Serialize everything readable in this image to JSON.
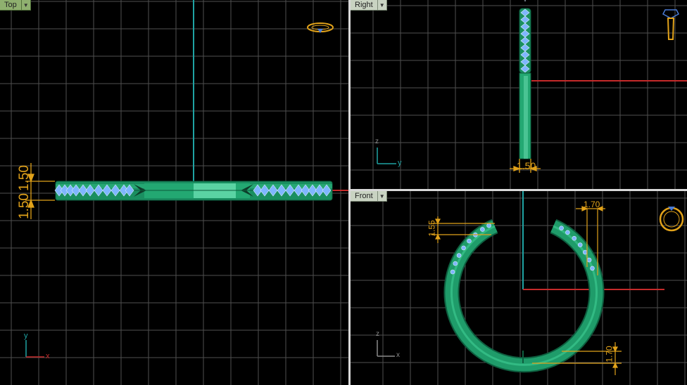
{
  "viewports": {
    "top": {
      "label": "Top",
      "dim_vertical": "1.50",
      "dim_vertical_2": "1.50",
      "axis_x": "x",
      "axis_y": "y"
    },
    "right": {
      "label": "Right",
      "dim_horizontal": "1.50",
      "axis_h": "y",
      "axis_v": "z"
    },
    "front": {
      "label": "Front",
      "dim_top_left": "1.55",
      "dim_top_right": "1.70",
      "dim_bottom": "1.70",
      "axis_h": "x",
      "axis_v": "z"
    }
  },
  "colors": {
    "background": "#000000",
    "grid": "#5a5a5a",
    "grid_major": "#8a8a8a",
    "ring_green": "#1f9c6a",
    "stones": "#7fb6ff",
    "dimension": "#e1a21a",
    "axis_x": "#c62a2a",
    "axis_y": "#1fa3a3",
    "label_bg_active": "#8fb06f",
    "label_bg": "#c9d3c2"
  },
  "icons": [
    "ring-top-icon",
    "ring-side-icon",
    "ring-front-icon",
    "dropdown-arrow-icon"
  ]
}
